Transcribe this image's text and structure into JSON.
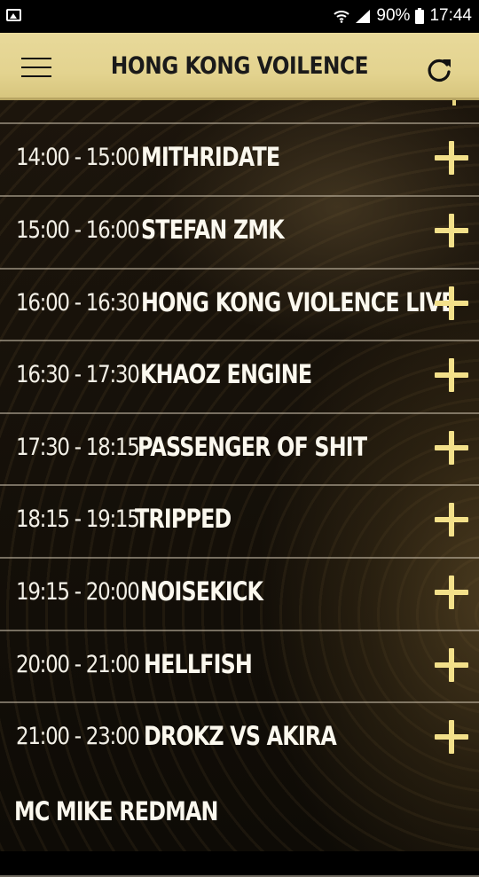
{
  "status_bar": {
    "battery_percent": "90%",
    "time": "17:44",
    "icons": [
      "gallery-icon",
      "wifi-icon",
      "signal-icon",
      "battery-icon"
    ]
  },
  "header": {
    "title": "HONG KONG VOILENCE",
    "menu_icon": "hamburger-menu-icon",
    "refresh_icon": "refresh-icon"
  },
  "schedule": [
    {
      "time": "14:00 - 15:00",
      "artist": "MITHRIDATE"
    },
    {
      "time": "15:00 - 16:00",
      "artist": "STEFAN ZMK"
    },
    {
      "time": "16:00 - 16:30",
      "artist": "HONG KONG VIOLENCE LIVE"
    },
    {
      "time": "16:30 - 17:30",
      "artist": "KHAOZ ENGINE"
    },
    {
      "time": "17:30 - 18:15",
      "artist": "PASSENGER OF SHIT"
    },
    {
      "time": "18:15 - 19:15",
      "artist": "TRIPPED"
    },
    {
      "time": "19:15 - 20:00",
      "artist": "NOISEKICK"
    },
    {
      "time": "20:00 - 21:00",
      "artist": "HELLFISH"
    },
    {
      "time": "21:00 - 23:00",
      "artist": "DROKZ VS AKIRA"
    }
  ],
  "footer_host": "MC MIKE REDMAN",
  "colors": {
    "header_bg": "#e3d38f",
    "accent_plus": "#f3e08a",
    "text": "#fbf8ee",
    "background": "#0e0b06"
  }
}
